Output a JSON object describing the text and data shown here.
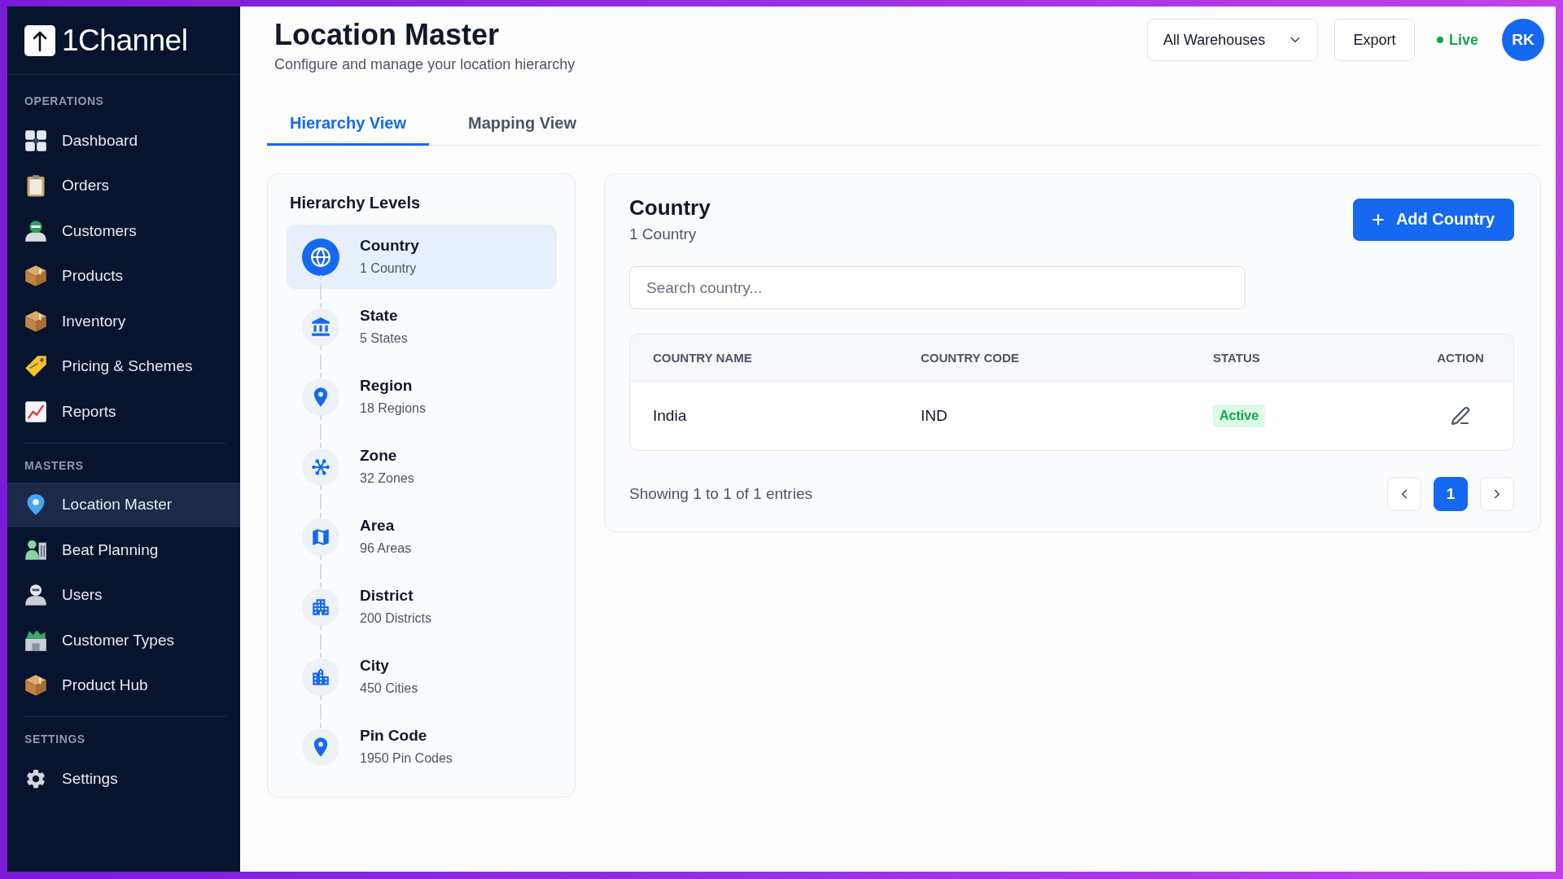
{
  "sidebar": {
    "logo": "1Channel",
    "sections": [
      {
        "title": "OPERATIONS",
        "items": [
          {
            "label": "Dashboard",
            "selected": false
          },
          {
            "label": "Orders",
            "selected": false
          },
          {
            "label": "Customers",
            "selected": false
          },
          {
            "label": "Products",
            "selected": false
          },
          {
            "label": "Inventory",
            "selected": false
          },
          {
            "label": "Pricing & Schemes",
            "selected": false
          },
          {
            "label": "Reports",
            "selected": false
          }
        ]
      },
      {
        "title": "MASTERS",
        "items": [
          {
            "label": "Location Master",
            "selected": true
          },
          {
            "label": "Beat Planning",
            "selected": false
          },
          {
            "label": "Users",
            "selected": false
          },
          {
            "label": "Customer Types",
            "selected": false
          },
          {
            "label": "Product Hub",
            "selected": false
          }
        ]
      },
      {
        "title": "SETTINGS",
        "items": [
          {
            "label": "Settings",
            "selected": false
          }
        ]
      }
    ]
  },
  "header": {
    "title": "Location Master",
    "subtitle": "Configure and manage your location hierarchy",
    "warehouse_select": {
      "value": "All Warehouses"
    },
    "export_button": "Export",
    "status": "Live",
    "avatar": "RK"
  },
  "tabs": [
    {
      "label": "Hierarchy View",
      "selected": true
    },
    {
      "label": "Mapping View",
      "selected": false
    }
  ],
  "hierarchy": {
    "title": "Hierarchy Levels",
    "levels": [
      {
        "name": "Country",
        "count": "1 Country",
        "selected": true
      },
      {
        "name": "State",
        "count": "5 States",
        "selected": false
      },
      {
        "name": "Region",
        "count": "18 Regions",
        "selected": false
      },
      {
        "name": "Zone",
        "count": "32 Zones",
        "selected": false
      },
      {
        "name": "Area",
        "count": "96 Areas",
        "selected": false
      },
      {
        "name": "District",
        "count": "200 Districts",
        "selected": false
      },
      {
        "name": "City",
        "count": "450 Cities",
        "selected": false
      },
      {
        "name": "Pin Code",
        "count": "1950 Pin Codes",
        "selected": false
      }
    ]
  },
  "detail": {
    "title": "Country",
    "subtitle": "1 Country",
    "add_button": "Add Country",
    "search": {
      "placeholder": "Search country..."
    },
    "table": {
      "columns": [
        "COUNTRY NAME",
        "COUNTRY CODE",
        "STATUS",
        "ACTION"
      ],
      "rows": [
        {
          "name": "India",
          "code": "IND",
          "status": "Active"
        }
      ]
    },
    "footer": "Showing 1 to 1 of 1 entries",
    "pages": [
      {
        "label": "1",
        "selected": true
      }
    ]
  }
}
